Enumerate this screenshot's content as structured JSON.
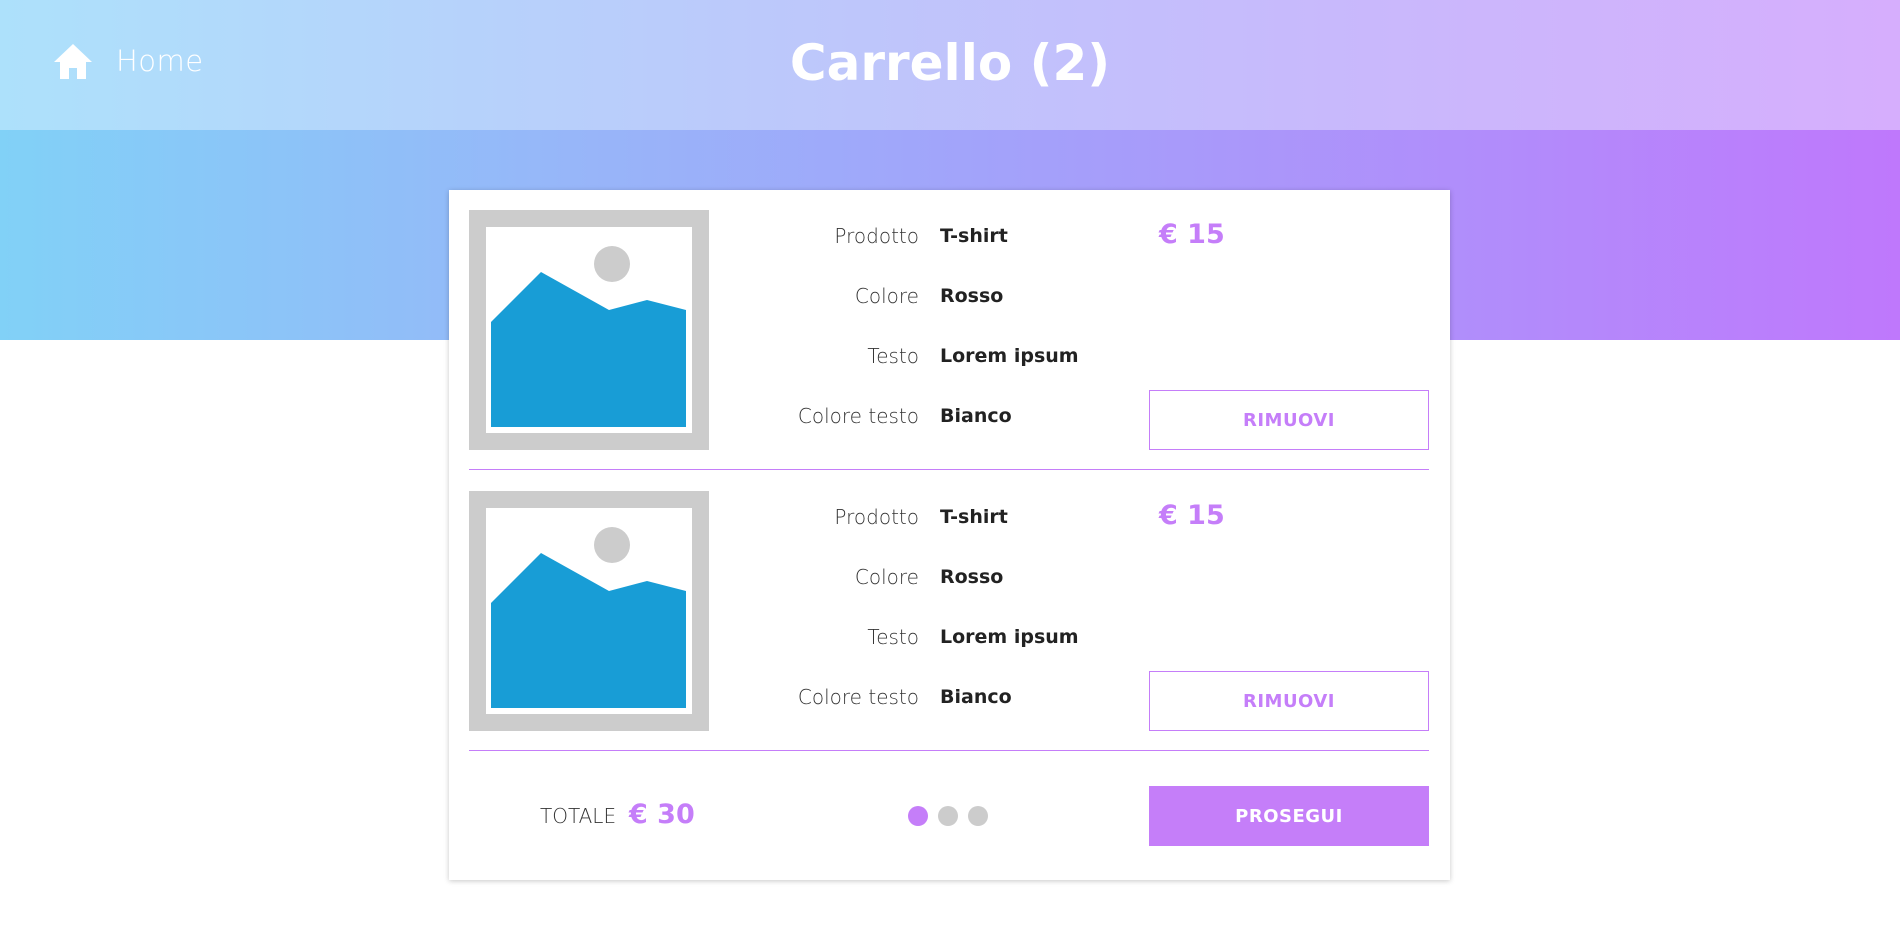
{
  "header": {
    "home_label": "Home",
    "home_icon": "home-icon",
    "title": "Carrello (2)"
  },
  "cart": {
    "items": [
      {
        "image_icon": "image-placeholder-icon",
        "attributes": [
          {
            "key": "Prodotto",
            "value": "T-shirt"
          },
          {
            "key": "Colore",
            "value": "Rosso"
          },
          {
            "key": "Testo",
            "value": "Lorem ipsum"
          },
          {
            "key": "Colore testo",
            "value": "Bianco"
          }
        ],
        "price": "€ 15",
        "remove_label": "RIMUOVI"
      },
      {
        "image_icon": "image-placeholder-icon",
        "attributes": [
          {
            "key": "Prodotto",
            "value": "T-shirt"
          },
          {
            "key": "Colore",
            "value": "Rosso"
          },
          {
            "key": "Testo",
            "value": "Lorem ipsum"
          },
          {
            "key": "Colore testo",
            "value": "Bianco"
          }
        ],
        "price": "€ 15",
        "remove_label": "RIMUOVI"
      }
    ]
  },
  "footer": {
    "total_label": "TOTALE",
    "total_value": "€ 30",
    "steps": {
      "count": 3,
      "current": 1
    },
    "continue_label": "PROSEGUI"
  },
  "colors": {
    "accent": "#c57ef9",
    "dot_inactive": "#cccccc",
    "image_frame": "#cccccc",
    "image_mountain": "#189dd6"
  }
}
